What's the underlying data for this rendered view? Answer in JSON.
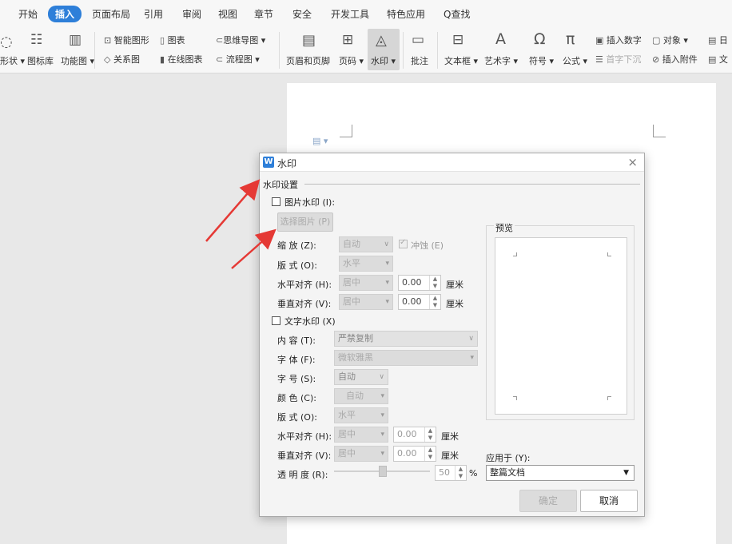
{
  "menu": {
    "tabs": [
      "开始",
      "插入",
      "页面布局",
      "引用",
      "审阅",
      "视图",
      "章节",
      "安全",
      "开发工具",
      "特色应用"
    ],
    "active": "插入",
    "search_label": "查找"
  },
  "toolbar": {
    "shape": "形状",
    "icon_lib": "图标库",
    "func_chart": "功能图",
    "smart_art": "智能图形",
    "relation": "关系图",
    "chart": "图表",
    "online_chart": "在线图表",
    "mindmap": "思维导图",
    "flowchart": "流程图",
    "header_footer": "页眉和页脚",
    "page_num": "页码",
    "watermark": "水印",
    "comment": "批注",
    "textbox": "文本框",
    "wordart": "艺术字",
    "symbol": "符号",
    "formula": "公式",
    "insert_number": "插入数字",
    "object": "对象",
    "date": "日",
    "drop_cap": "首字下沉",
    "attachment": "插入附件",
    "doc": "文"
  },
  "dialog": {
    "title": "水印",
    "close": "×",
    "section": "水印设置",
    "pic_watermark": "图片水印 (I):",
    "select_pic": "选择图片 (P)",
    "scale_label": "缩  放 (Z):",
    "scale_value": "自动",
    "washout": "冲蚀 (E)",
    "layout_label": "版  式 (O):",
    "layout_value": "水平",
    "halign_label": "水平对齐 (H):",
    "halign_value": "居中",
    "halign_num": "0.00",
    "valign_label": "垂直对齐 (V):",
    "valign_value": "居中",
    "valign_num": "0.00",
    "unit": "厘米",
    "text_watermark": "文字水印 (X)",
    "content_label": "内  容 (T):",
    "content_value": "严禁复制",
    "font_label": "字  体 (F):",
    "font_value": "微软雅黑",
    "size_label": "字  号 (S):",
    "size_value": "自动",
    "color_label": "颜  色 (C):",
    "color_value": "自动",
    "t_layout_label": "版  式 (O):",
    "t_layout_value": "水平",
    "t_halign_label": "水平对齐 (H):",
    "t_halign_value": "居中",
    "t_halign_num": "0.00",
    "t_valign_label": "垂直对齐 (V):",
    "t_valign_value": "居中",
    "t_valign_num": "0.00",
    "transparency_label": "透 明 度 (R):",
    "transparency_value": "50",
    "percent": "%",
    "preview": "预览",
    "apply_label": "应用于 (Y):",
    "apply_value": "整篇文档",
    "ok": "确定",
    "cancel": "取消"
  },
  "colors": {
    "accent": "#2e7fd9",
    "arrow": "#e53935"
  }
}
